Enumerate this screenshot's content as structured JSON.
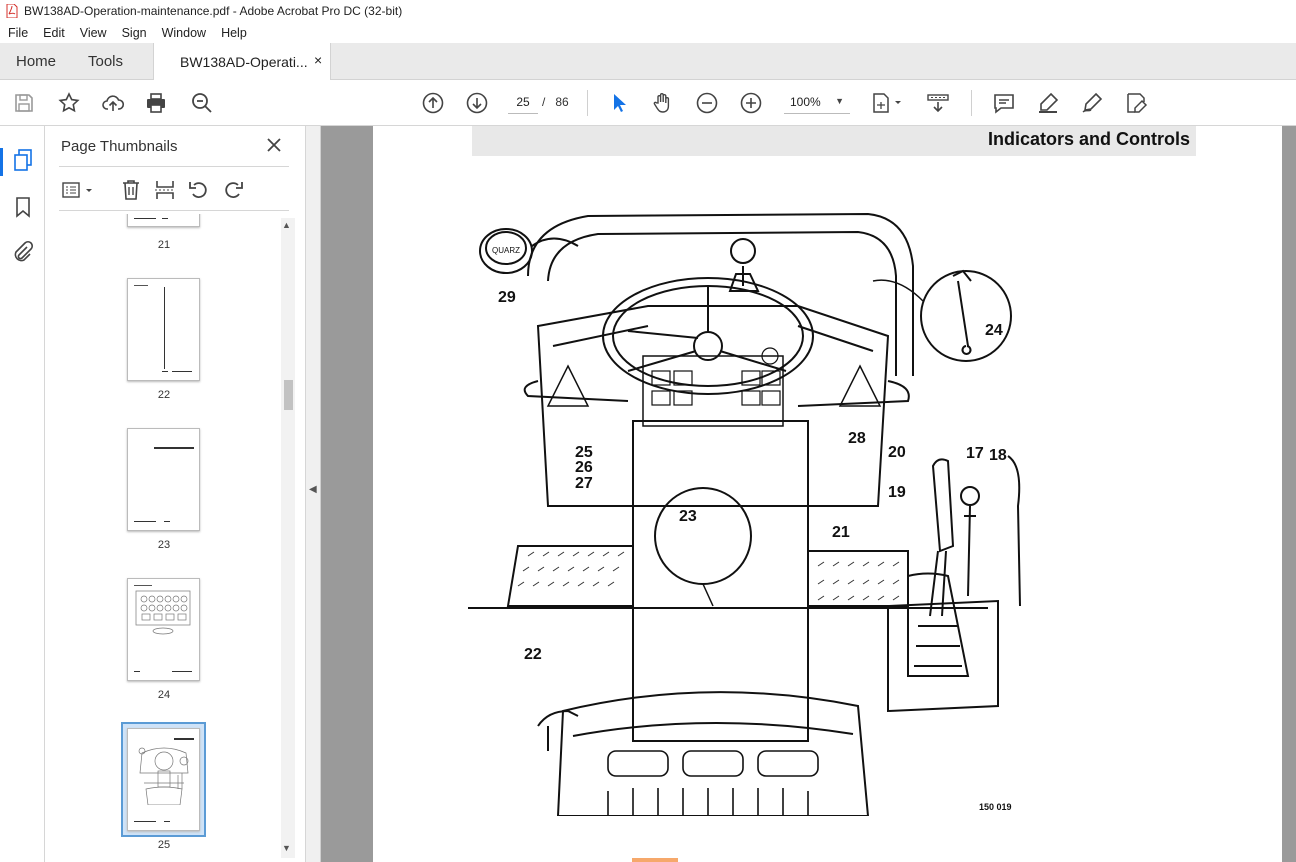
{
  "window": {
    "title": "BW138AD-Operation-maintenance.pdf - Adobe Acrobat Pro DC (32-bit)"
  },
  "menu": [
    "File",
    "Edit",
    "View",
    "Sign",
    "Window",
    "Help"
  ],
  "tabs": {
    "home": "Home",
    "tools": "Tools",
    "document": "BW138AD-Operati...",
    "close_symbol": "×"
  },
  "toolbar": {
    "current_page": "25",
    "page_separator": "/",
    "total_pages": "86",
    "zoom": "100%"
  },
  "thumbnails_panel": {
    "title": "Page Thumbnails",
    "pages": [
      {
        "number": "21"
      },
      {
        "number": "22"
      },
      {
        "number": "23"
      },
      {
        "number": "24"
      },
      {
        "number": "25",
        "selected": true
      }
    ]
  },
  "document": {
    "header": "Indicators and Controls",
    "figure_id": "150 019",
    "callouts": [
      "29",
      "24",
      "28",
      "25",
      "26",
      "27",
      "20",
      "17",
      "18",
      "19",
      "23",
      "21",
      "22"
    ],
    "gauge_label": "QUARZ"
  },
  "colors": {
    "accent": "#1473e6",
    "thumb_selected": "#cfe3f8",
    "canvas": "#9a9a9a"
  }
}
